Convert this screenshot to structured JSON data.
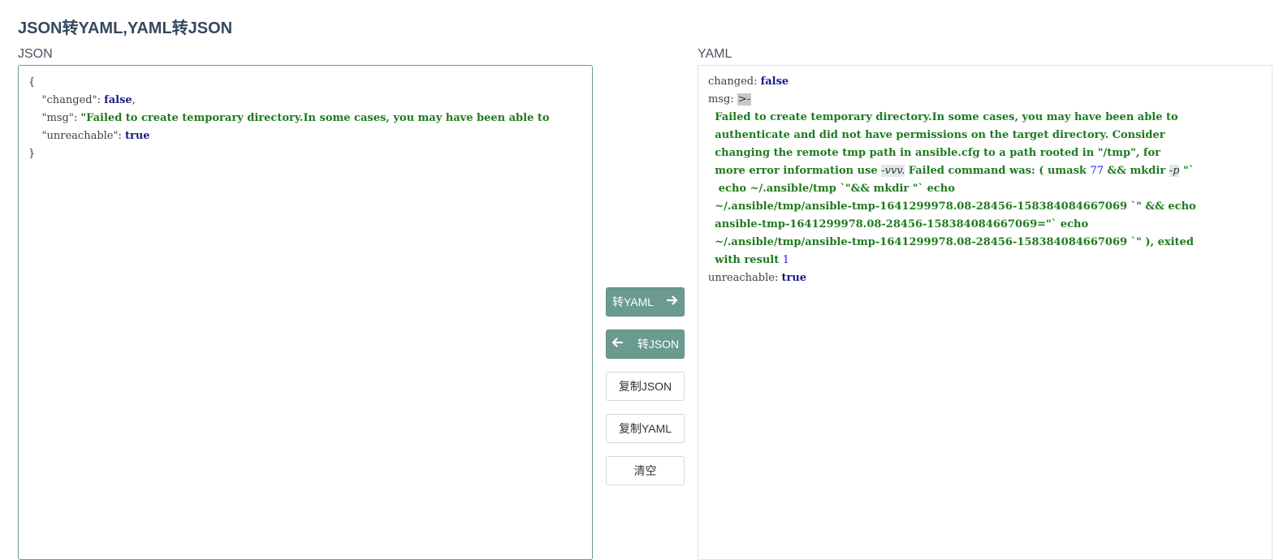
{
  "page": {
    "title": "JSON转YAML,YAML转JSON"
  },
  "json_panel": {
    "label": "JSON",
    "lines": {
      "open_brace": "{",
      "changed_key": "\"changed\"",
      "changed_value": "false",
      "msg_key": "\"msg\"",
      "msg_value": "\"Failed to create temporary directory.In some cases, you may have been able to",
      "unreachable_key": "\"unreachable\"",
      "unreachable_value": "true",
      "close_brace": "}"
    }
  },
  "yaml_panel": {
    "label": "YAML",
    "changed_key": "changed",
    "changed_value": "false",
    "msg_key": "msg",
    "msg_fold": ">-",
    "msg_lines": {
      "l1": "Failed to create temporary directory.In some cases, you may have been able to",
      "l2": "authenticate and did not have permissions on the target directory. Consider",
      "l3": "changing the remote tmp path in ansible.cfg to a path rooted in \"/tmp\", for",
      "l4a": "more error information use ",
      "l4b": "-vvv.",
      "l4c": " Failed command was: ( umask ",
      "l4d": "77",
      "l4e": " && mkdir ",
      "l4f": "-p",
      "l4g": " \"`",
      "l5": " echo ~/.ansible/tmp `\"&& mkdir \"` echo",
      "l6": "~/.ansible/tmp/ansible-tmp-1641299978.08-28456-158384084667069 `\" && echo",
      "l7": "ansible-tmp-1641299978.08-28456-158384084667069=\"` echo",
      "l8": "~/.ansible/tmp/ansible-tmp-1641299978.08-28456-158384084667069 `\" ), exited",
      "l9a": "with result ",
      "l9b": "1"
    },
    "unreachable_key": "unreachable",
    "unreachable_value": "true"
  },
  "buttons": {
    "to_yaml": "转YAML",
    "to_json": "转JSON",
    "copy_json": "复制JSON",
    "copy_yaml": "复制YAML",
    "clear": "清空"
  },
  "icons": {
    "to_yaml": "arrow-right-icon",
    "to_json": "arrow-left-icon"
  },
  "colors": {
    "primary": "#6b9a8f",
    "title": "#34495e"
  }
}
